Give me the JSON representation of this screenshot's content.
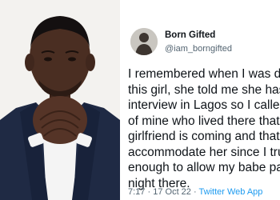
{
  "photo": {
    "icon": "man-praying-hands",
    "background_color": "#f3f2ef",
    "suit_color": "#1f2a44",
    "shirt_color": "#f4f4f4",
    "skin_color": "#4a2e22"
  },
  "tweet": {
    "display_name": "Born Gifted",
    "handle": "@iam_borngifted",
    "lines": [
      "I remembered when I was da",
      "this girl, she told me she has",
      "interview in Lagos so I called",
      "of mine who lived there that",
      "girlfriend is coming and that",
      "accommodate her since I tru",
      "enough to allow my babe pa",
      "night there."
    ],
    "time": "7:17",
    "separator": "·",
    "date": "17 Oct 22",
    "source": "Twitter Web App",
    "text_color": "#0f1419",
    "secondary_color": "#536471",
    "link_color": "#1d9bf0"
  }
}
